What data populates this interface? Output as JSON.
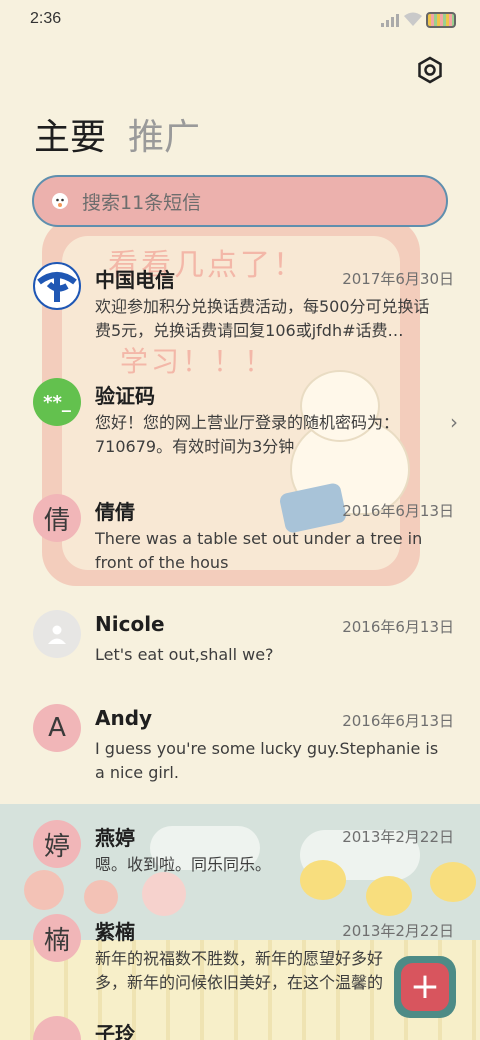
{
  "status": {
    "time": "2:36"
  },
  "wallpaper": {
    "line1": "看看几点了！",
    "line2": "学习！！！"
  },
  "tabs": [
    {
      "label": "主要"
    },
    {
      "label": "推广"
    }
  ],
  "search": {
    "placeholder": "搜索11条短信"
  },
  "messages": [
    {
      "name": "中国电信",
      "date": "2017年6月30日",
      "avatar": "",
      "text": "欢迎参加积分兑换话费活动，每500分可兑换话费5元，兑换话费请回复106或jfdh#话费…"
    },
    {
      "name": "验证码",
      "date": "",
      "avatar": "**_",
      "text": "您好！您的网上营业厅登录的随机密码为：710679。有效时间为3分钟"
    },
    {
      "name": "倩倩",
      "date": "2016年6月13日",
      "avatar": "倩",
      "text": "There was a table set out under a tree in front of the hous"
    },
    {
      "name": "Nicole",
      "date": "2016年6月13日",
      "avatar": "",
      "text": "Let's eat out,shall we?"
    },
    {
      "name": "Andy",
      "date": "2016年6月13日",
      "avatar": "A",
      "text": "I guess you're some lucky guy.Stephanie is a nice girl."
    },
    {
      "name": "燕婷",
      "date": "2013年2月22日",
      "avatar": "婷",
      "text": "嗯。收到啦。同乐同乐。"
    },
    {
      "name": "紫楠",
      "date": "2013年2月22日",
      "avatar": "楠",
      "text": "新年的祝福数不胜数，新年的愿望好多好多，新年的问候依旧美好，在这个温馨的时刻"
    },
    {
      "name": "子玲",
      "date": "",
      "avatar": "",
      "text": ""
    }
  ],
  "fab": {
    "label": "+"
  },
  "colors": {
    "accent": "#d8555e",
    "search_bg": "#ecb1ad",
    "background": "#f7f1de"
  }
}
